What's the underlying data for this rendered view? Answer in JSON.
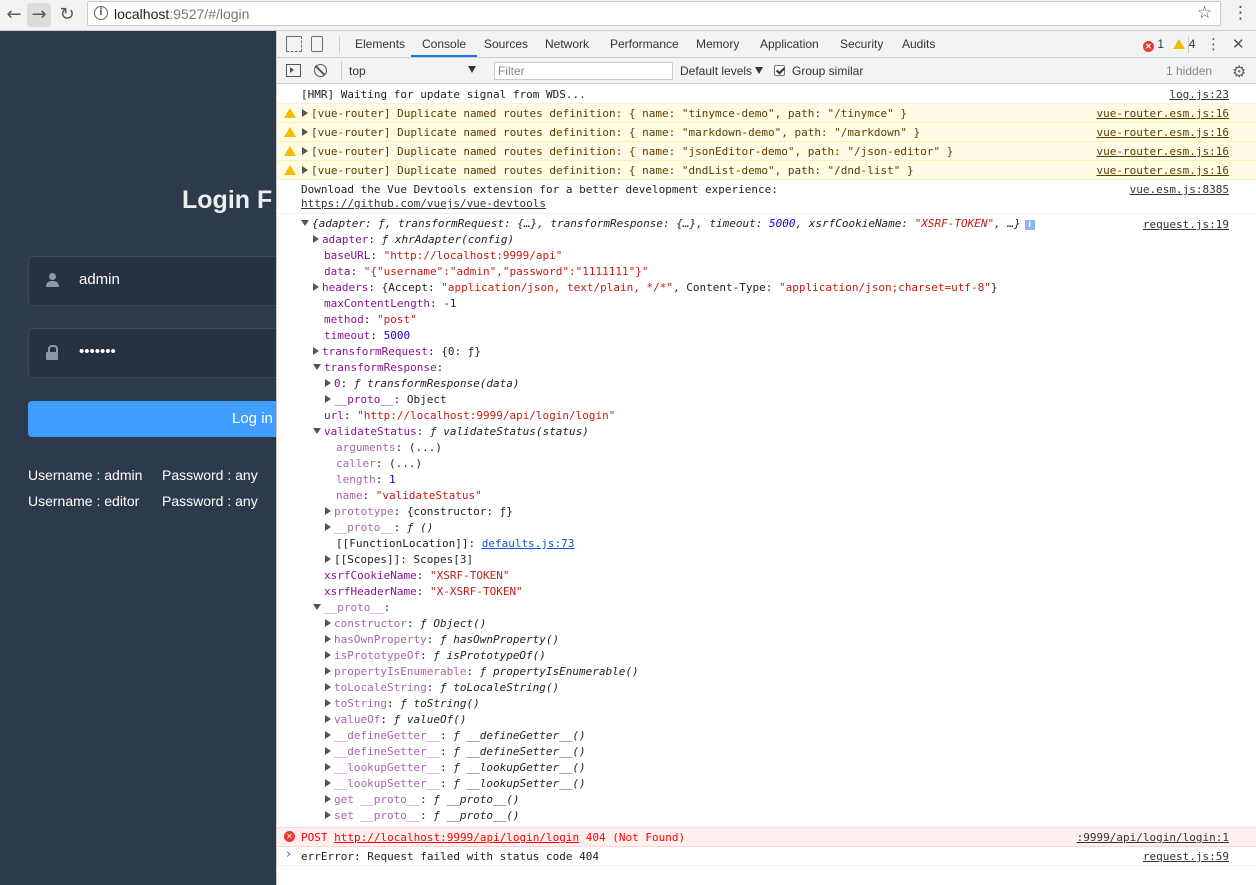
{
  "browser": {
    "url_host": "localhost",
    "url_rest": ":9527/#/login"
  },
  "login": {
    "title": "Login F",
    "username": "admin",
    "password_masked": "•••••••",
    "button_label": "Log in",
    "tip1_user": "Username : admin",
    "tip1_pass": "Password : any",
    "tip2_user": "Username : editor",
    "tip2_pass": "Password : any"
  },
  "devtools": {
    "tabs": [
      "Elements",
      "Console",
      "Sources",
      "Network",
      "Performance",
      "Memory",
      "Application",
      "Security",
      "Audits"
    ],
    "active_tab": "Console",
    "error_count": "1",
    "warning_count": "4",
    "context": "top",
    "filter_placeholder": "Filter",
    "levels_label": "Default levels",
    "group_similar_label": "Group similar",
    "hidden_label": "1 hidden"
  },
  "console": {
    "hmr": {
      "text": "[HMR] Waiting for update signal from WDS...",
      "source": "log.js:23"
    },
    "warnings": [
      {
        "text": "[vue-router] Duplicate named routes definition: { name: \"tinymce-demo\", path: \"/tinymce\" }",
        "source": "vue-router.esm.js:16"
      },
      {
        "text": "[vue-router] Duplicate named routes definition: { name: \"markdown-demo\", path: \"/markdown\" }",
        "source": "vue-router.esm.js:16"
      },
      {
        "text": "[vue-router] Duplicate named routes definition: { name: \"jsonEditor-demo\", path: \"/json-editor\" }",
        "source": "vue-router.esm.js:16"
      },
      {
        "text": "[vue-router] Duplicate named routes definition: { name: \"dndList-demo\", path: \"/dnd-list\" }",
        "source": "vue-router.esm.js:16"
      }
    ],
    "devtools_msg": {
      "line1": "Download the Vue Devtools extension for a better development experience:",
      "link": "https://github.com/vuejs/vue-devtools",
      "source": "vue.esm.js:8385"
    },
    "object_source": "request.js:19",
    "object_summary": {
      "p1": "{adapter: ƒ, transformRequest: {…}, transformResponse: {…}, timeout: ",
      "timeout": "5000",
      "p2": ", xsrfCookieName: ",
      "xsrf": "\"XSRF-TOKEN\"",
      "p3": ", …}"
    },
    "tree": {
      "adapter_k": "adapter",
      "adapter_v": "ƒ xhrAdapter(config)",
      "baseurl_k": "baseURL",
      "baseurl_v": "\"http://localhost:9999/api\"",
      "data_k": "data",
      "data_v": "\"{\"username\":\"admin\",\"password\":\"1111111\"}\"",
      "headers_k": "headers",
      "headers_p1": "{Accept: ",
      "headers_accept": "\"application/json, text/plain, */*\"",
      "headers_p2": ", Content-Type: ",
      "headers_ct": "\"application/json;charset=utf-8\"",
      "headers_p3": "}",
      "maxlen_k": "maxContentLength",
      "maxlen_v": "-1",
      "method_k": "method",
      "method_v": "\"post\"",
      "timeout_k": "timeout",
      "timeout_v": "5000",
      "treq_k": "transformRequest",
      "treq_v": "{0: ƒ}",
      "tres_k": "transformResponse",
      "tres0_k": "0",
      "tres0_v": "ƒ transformResponse(data)",
      "proto1_k": "__proto__",
      "proto1_v": "Object",
      "url_k": "url",
      "url_v": "\"http://localhost:9999/api/login/login\"",
      "vs_k": "validateStatus",
      "vs_v": "ƒ validateStatus(status)",
      "args_k": "arguments",
      "args_v": "(...)",
      "caller_k": "caller",
      "caller_v": "(...)",
      "length_k": "length",
      "length_v": "1",
      "name_k": "name",
      "name_v": "\"validateStatus\"",
      "prototype_k": "prototype",
      "prototype_v": "{constructor: ƒ}",
      "proto2_k": "__proto__",
      "proto2_v": "ƒ ()",
      "fnloc_k": "[[FunctionLocation]]",
      "fnloc_v": "defaults.js:73",
      "scopes_k": "[[Scopes]]",
      "scopes_v": "Scopes[3]",
      "xck_k": "xsrfCookieName",
      "xck_v": "\"XSRF-TOKEN\"",
      "xhk_k": "xsrfHeaderName",
      "xhk_v": "\"X-XSRF-TOKEN\"",
      "proto3_k": "__proto__",
      "proto_items": [
        {
          "k": "constructor",
          "v": "ƒ Object()"
        },
        {
          "k": "hasOwnProperty",
          "v": "ƒ hasOwnProperty()"
        },
        {
          "k": "isPrototypeOf",
          "v": "ƒ isPrototypeOf()"
        },
        {
          "k": "propertyIsEnumerable",
          "v": "ƒ propertyIsEnumerable()"
        },
        {
          "k": "toLocaleString",
          "v": "ƒ toLocaleString()"
        },
        {
          "k": "toString",
          "v": "ƒ toString()"
        },
        {
          "k": "valueOf",
          "v": "ƒ valueOf()"
        },
        {
          "k": "__defineGetter__",
          "v": "ƒ __defineGetter__()"
        },
        {
          "k": "__defineSetter__",
          "v": "ƒ __defineSetter__()"
        },
        {
          "k": "__lookupGetter__",
          "v": "ƒ __lookupGetter__()"
        },
        {
          "k": "__lookupSetter__",
          "v": "ƒ __lookupSetter__()"
        },
        {
          "k": "get __proto__",
          "v": "ƒ __proto__()"
        },
        {
          "k": "set __proto__",
          "v": "ƒ __proto__()"
        }
      ]
    },
    "error": {
      "prefix": "POST ",
      "url": "http://localhost:9999/api/login/login",
      "suffix": " 404 (Not Found)",
      "source": ":9999/api/login/login:1"
    },
    "err_text": {
      "text": "errError: Request failed with status code 404",
      "source": "request.js:59"
    },
    "prompt": "›"
  },
  "colors": {
    "login_bg": "#2d3a4b",
    "login_button": "#409eff",
    "warning_bg": "#fffbe5",
    "error_bg": "#fff0f0",
    "active_tab_underline": "#1a73e8"
  }
}
